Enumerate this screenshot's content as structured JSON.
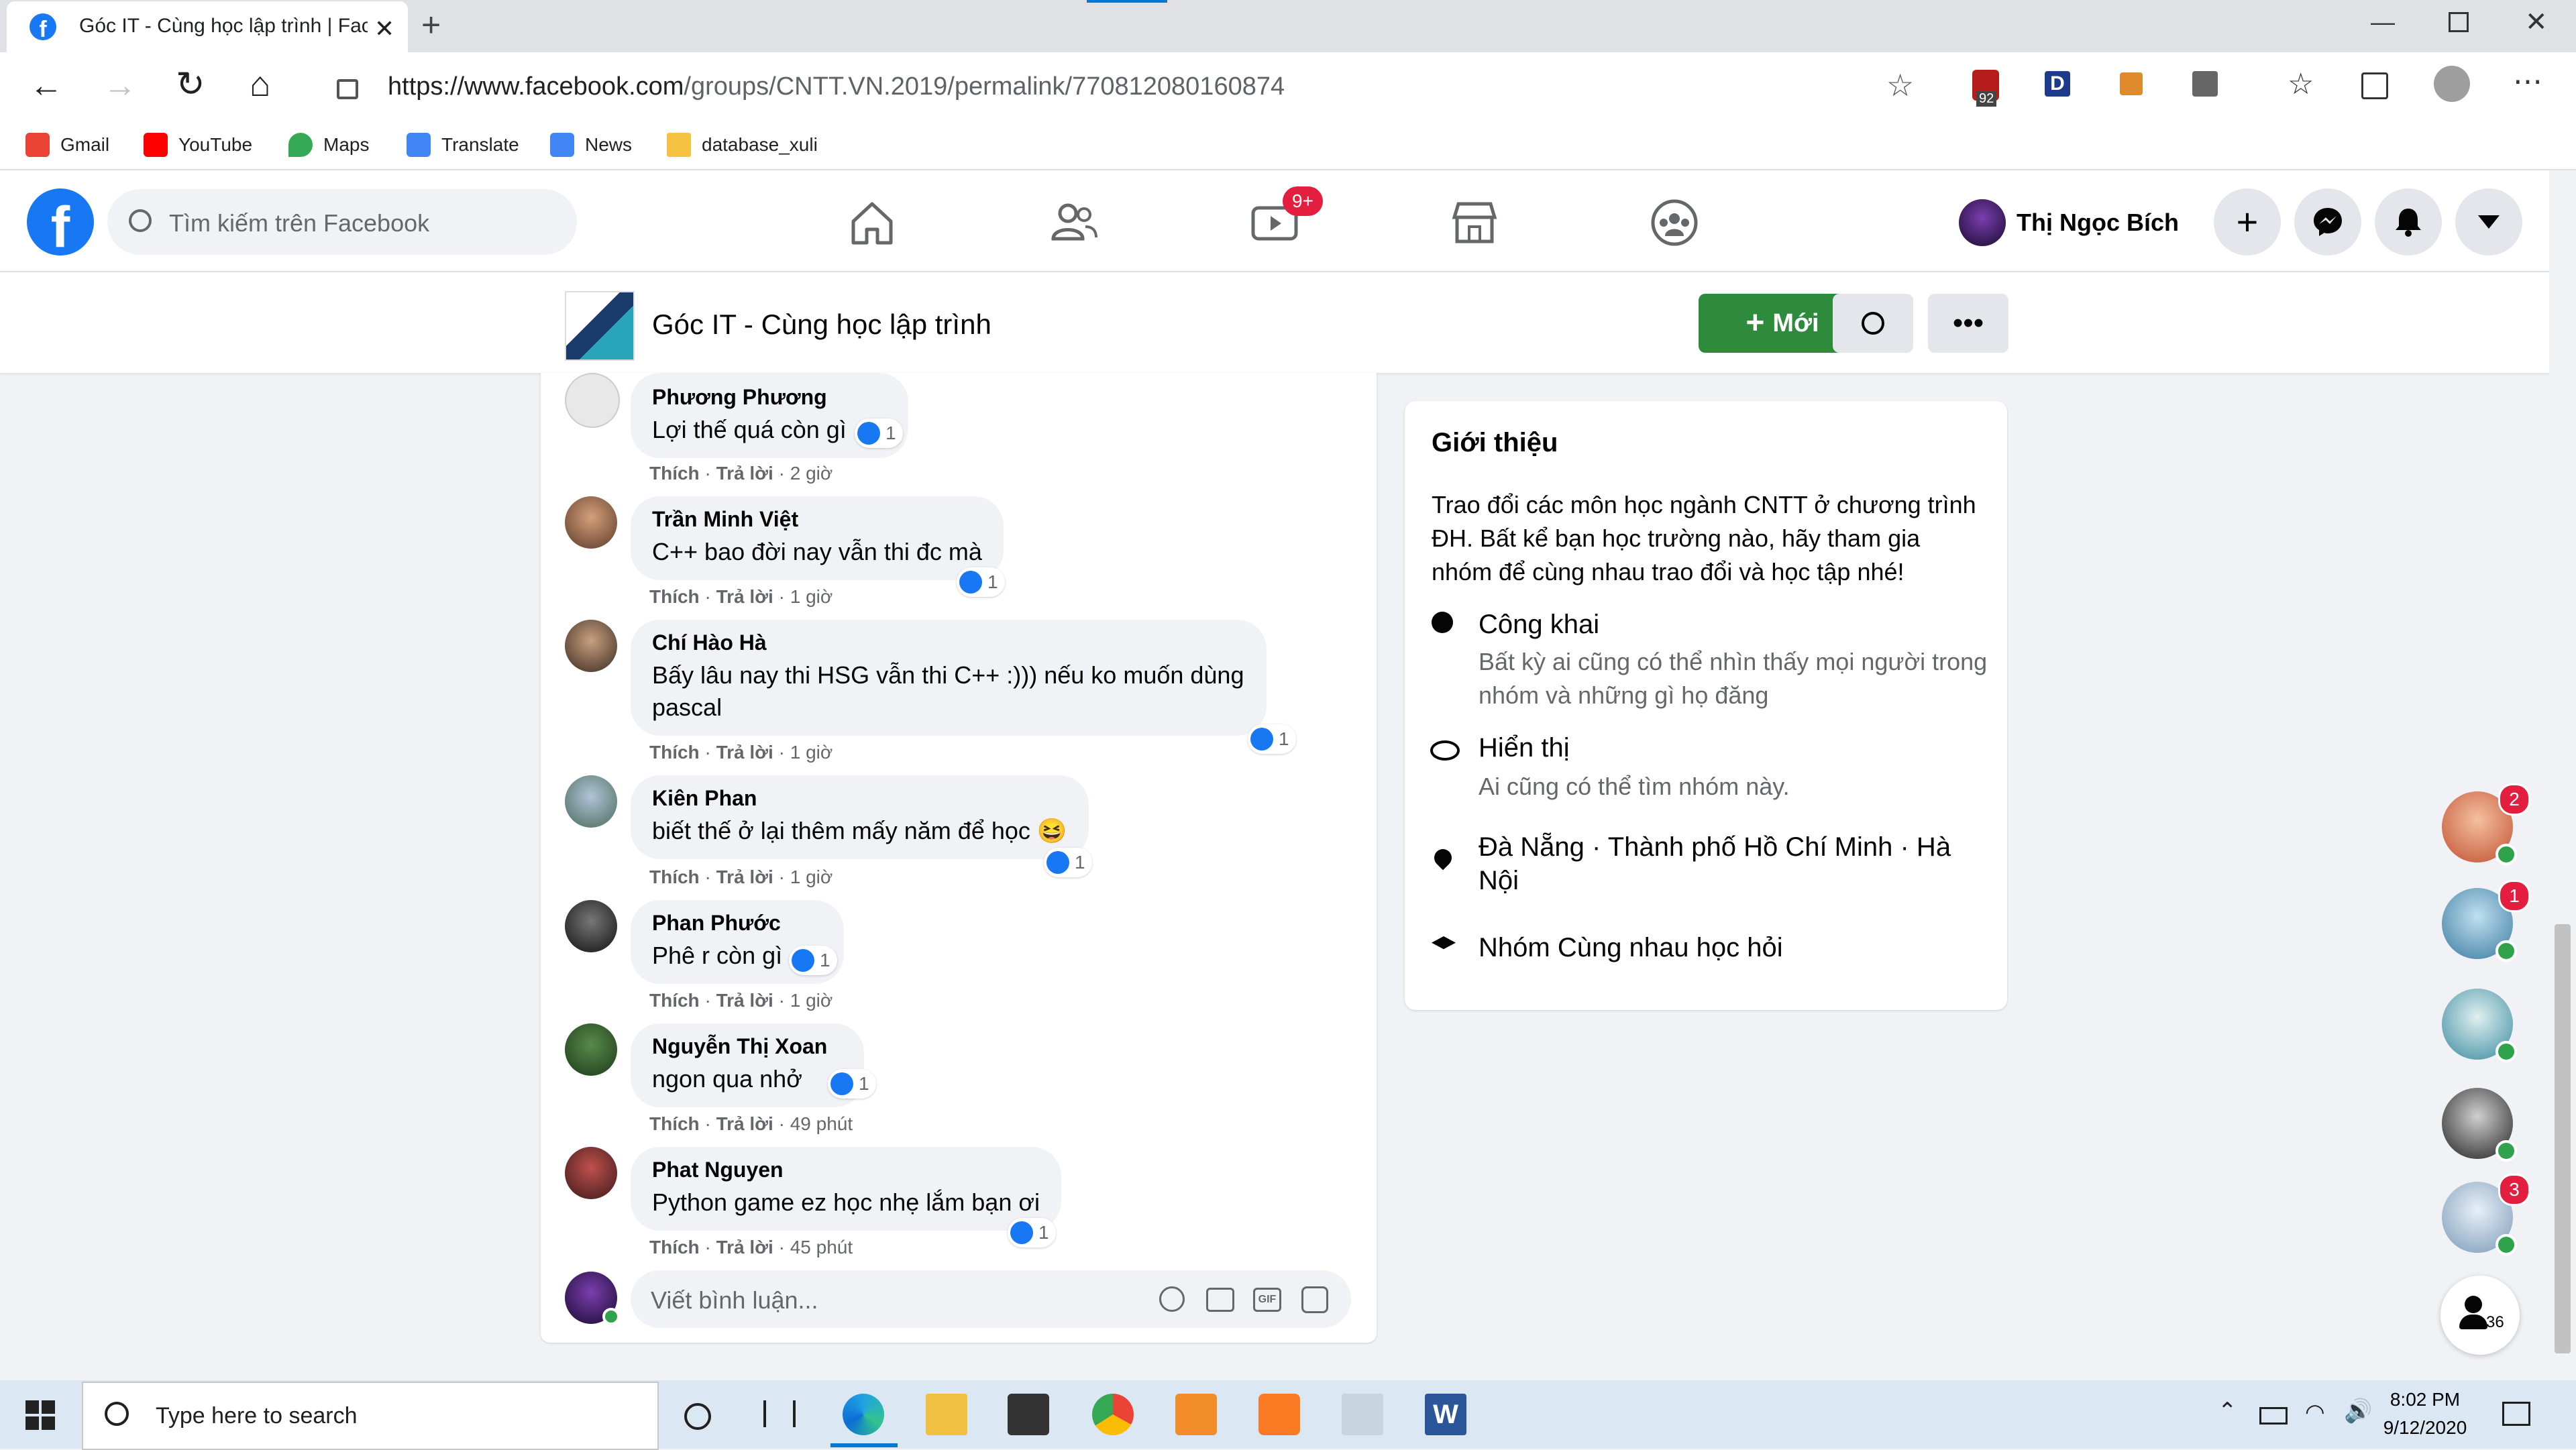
{
  "browser": {
    "tab_title": "Góc IT - Cùng học lập trình | Face",
    "url_prefix": "https://www.facebook.com",
    "url_rest": "/groups/CNTT.VN.2019/permalink/770812080160874",
    "ext_badge": "92",
    "bookmarks": [
      {
        "label": "Gmail",
        "color": "#ea4335"
      },
      {
        "label": "YouTube",
        "color": "#ff0000"
      },
      {
        "label": "Maps",
        "color": "#34a853"
      },
      {
        "label": "Translate",
        "color": "#4285f4"
      },
      {
        "label": "News",
        "color": "#4285f4"
      },
      {
        "label": "database_xuli",
        "color": "#f5c242"
      }
    ]
  },
  "fb": {
    "search_placeholder": "Tìm kiếm trên Facebook",
    "watch_badge": "9+",
    "user_name": "Thị Ngọc Bích",
    "group_title": "Góc IT - Cùng học lập trình",
    "new_button": "Mới"
  },
  "comments": [
    {
      "name": "Phương Phương",
      "text": "Lợi thế quá còn gì",
      "likes": "1",
      "time": "2 giờ"
    },
    {
      "name": "Trần Minh Việt",
      "text": "C++ bao đời nay vẫn thi đc mà",
      "likes": "1",
      "time": "1 giờ"
    },
    {
      "name": "Chí Hào Hà",
      "text": "Bấy lâu nay thi HSG vẫn thi C++ :))) nếu ko muốn dùng pascal",
      "likes": "1",
      "time": "1 giờ"
    },
    {
      "name": "Kiên Phan",
      "text": "biết thế ở lại thêm mấy năm để học 😆",
      "likes": "1",
      "time": "1 giờ"
    },
    {
      "name": "Phan Phước",
      "text": "Phê r còn gì",
      "likes": "1",
      "time": "1 giờ"
    },
    {
      "name": "Nguyễn Thị Xoan",
      "text": "ngon qua nhở",
      "likes": "1",
      "time": "49 phút"
    },
    {
      "name": "Phat Nguyen",
      "text": "Python game ez học nhẹ lắm bạn ơi",
      "likes": "1",
      "time": "45 phút"
    }
  ],
  "comment_actions": {
    "like": "Thích",
    "reply": "Trả lời"
  },
  "compose_placeholder": "Viết bình luận...",
  "intro": {
    "title": "Giới thiệu",
    "description": "Trao đổi các môn học ngành CNTT ở chương trình ĐH. Bất kể bạn học trường nào, hãy tham gia nhóm để cùng nhau trao đổi và học tập nhé!",
    "privacy_title": "Công khai",
    "privacy_desc": "Bất kỳ ai cũng có thể nhìn thấy mọi người trong nhóm và những gì họ đăng",
    "visibility_title": "Hiển thị",
    "visibility_desc": "Ai cũng có thể tìm nhóm này.",
    "location": "Đà Nẵng · Thành phố Hồ Chí Minh · Hà Nội",
    "group_type": "Nhóm Cùng nhau học hỏi"
  },
  "chat": {
    "badges": [
      "2",
      "1",
      "3"
    ],
    "contacts_count": "36"
  },
  "taskbar": {
    "search_placeholder": "Type here to search",
    "time": "8:02 PM",
    "date": "9/12/2020"
  }
}
